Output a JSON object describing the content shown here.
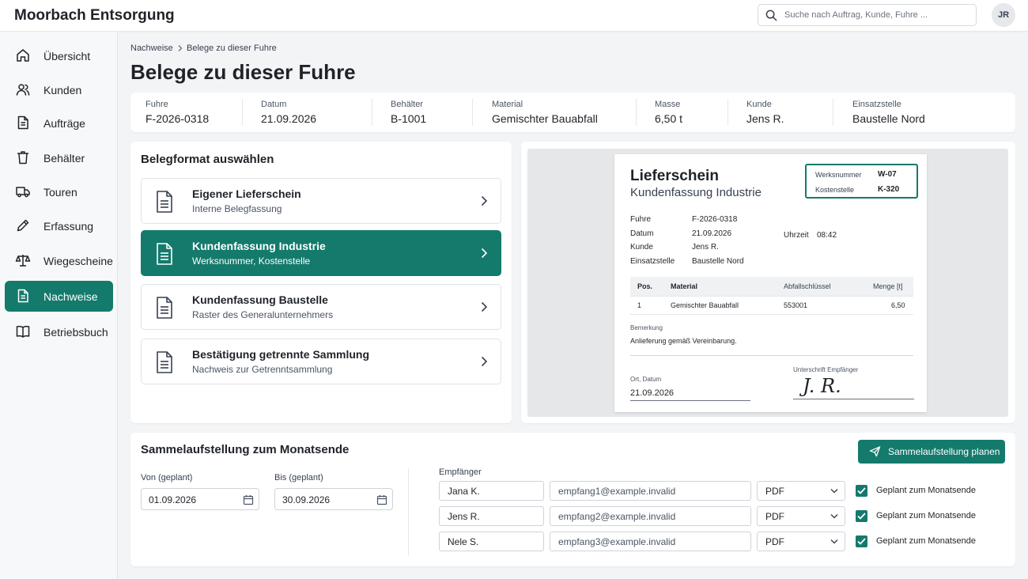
{
  "app": {
    "title": "Moorbach Entsorgung",
    "search_placeholder": "Suche nach Auftrag, Kunde, Fuhre ...",
    "user_initials": "JR"
  },
  "sidebar": {
    "items": [
      {
        "label": "Übersicht",
        "icon": "home-icon"
      },
      {
        "label": "Kunden",
        "icon": "users-icon"
      },
      {
        "label": "Aufträge",
        "icon": "document-icon"
      },
      {
        "label": "Behälter",
        "icon": "bin-icon"
      },
      {
        "label": "Touren",
        "icon": "truck-icon"
      },
      {
        "label": "Erfassung",
        "icon": "pencil-icon"
      },
      {
        "label": "Wiegescheine",
        "icon": "scale-icon"
      },
      {
        "label": "Nachweise",
        "icon": "document-icon",
        "active": true
      },
      {
        "label": "Betriebsbuch",
        "icon": "book-icon"
      }
    ]
  },
  "breadcrumb": {
    "parent": "Nachweise",
    "current": "Belege zu dieser Fuhre"
  },
  "page_title": "Belege zu dieser Fuhre",
  "info": [
    {
      "label": "Fuhre",
      "value": "F-2026-0318"
    },
    {
      "label": "Datum",
      "value": "21.09.2026"
    },
    {
      "label": "Behälter",
      "value": "B-1001"
    },
    {
      "label": "Material",
      "value": "Gemischter Bauabfall"
    },
    {
      "label": "Masse",
      "value": "6,50 t"
    },
    {
      "label": "Kunde",
      "value": "Jens R."
    },
    {
      "label": "Einsatzstelle",
      "value": "Baustelle Nord"
    }
  ],
  "formats": {
    "title": "Belegformat auswählen",
    "options": [
      {
        "title": "Eigener Lieferschein",
        "subtitle": "Interne Belegfassung"
      },
      {
        "title": "Kundenfassung Industrie",
        "subtitle": "Werksnummer, Kostenstelle",
        "selected": true
      },
      {
        "title": "Kundenfassung Baustelle",
        "subtitle": "Raster des Generalunternehmers"
      },
      {
        "title": "Bestätigung getrennte Sammlung",
        "subtitle": "Nachweis zur Getrenntsammlung"
      }
    ]
  },
  "preview": {
    "title": "Lieferschein",
    "subtitle": "Kundenfassung Industrie",
    "werks_label": "Werksnummer",
    "werks_value": "W-07",
    "kst_label": "Kostenstelle",
    "kst_value": "K-320",
    "fields": [
      {
        "label": "Fuhre",
        "value": "F-2026-0318"
      },
      {
        "label": "Datum",
        "value": "21.09.2026"
      },
      {
        "label": "Kunde",
        "value": "Jens R."
      },
      {
        "label": "Einsatzstelle",
        "value": "Baustelle Nord"
      }
    ],
    "time_label": "Uhrzeit",
    "time_value": "08:42",
    "table_headers": [
      "Pos.",
      "Material",
      "Abfallschlüssel",
      "Menge [t]"
    ],
    "table_row": [
      "1",
      "Gemischter Bauabfall",
      "553001",
      "6,50"
    ],
    "remark_label": "Bemerkung",
    "remark_text": "Anlieferung gemäß Vereinbarung.",
    "place_date_label": "Ort, Datum",
    "place_date_value": "21.09.2026",
    "signature_label": "Unterschrift Empfänger",
    "signature": "J. R."
  },
  "monthly": {
    "title": "Sammelaufstellung zum Monatsende",
    "button": "Sammelaufstellung planen",
    "from_label": "Von (geplant)",
    "from_value": "01.09.2026",
    "to_label": "Bis (geplant)",
    "to_value": "30.09.2026",
    "recipients_label": "Empfänger",
    "recipients": [
      {
        "name": "Jana K.",
        "email": "empfang1@example.invalid",
        "format": "PDF",
        "checked": true,
        "check_label": "Geplant zum Monatsende"
      },
      {
        "name": "Jens R.",
        "email": "empfang2@example.invalid",
        "format": "PDF",
        "checked": true,
        "check_label": "Geplant zum Monatsende"
      },
      {
        "name": "Nele S.",
        "email": "empfang3@example.invalid",
        "format": "PDF",
        "checked": true,
        "check_label": "Geplant zum Monatsende"
      }
    ]
  },
  "colors": {
    "accent": "#147a6c",
    "background": "#f3f4f6"
  }
}
